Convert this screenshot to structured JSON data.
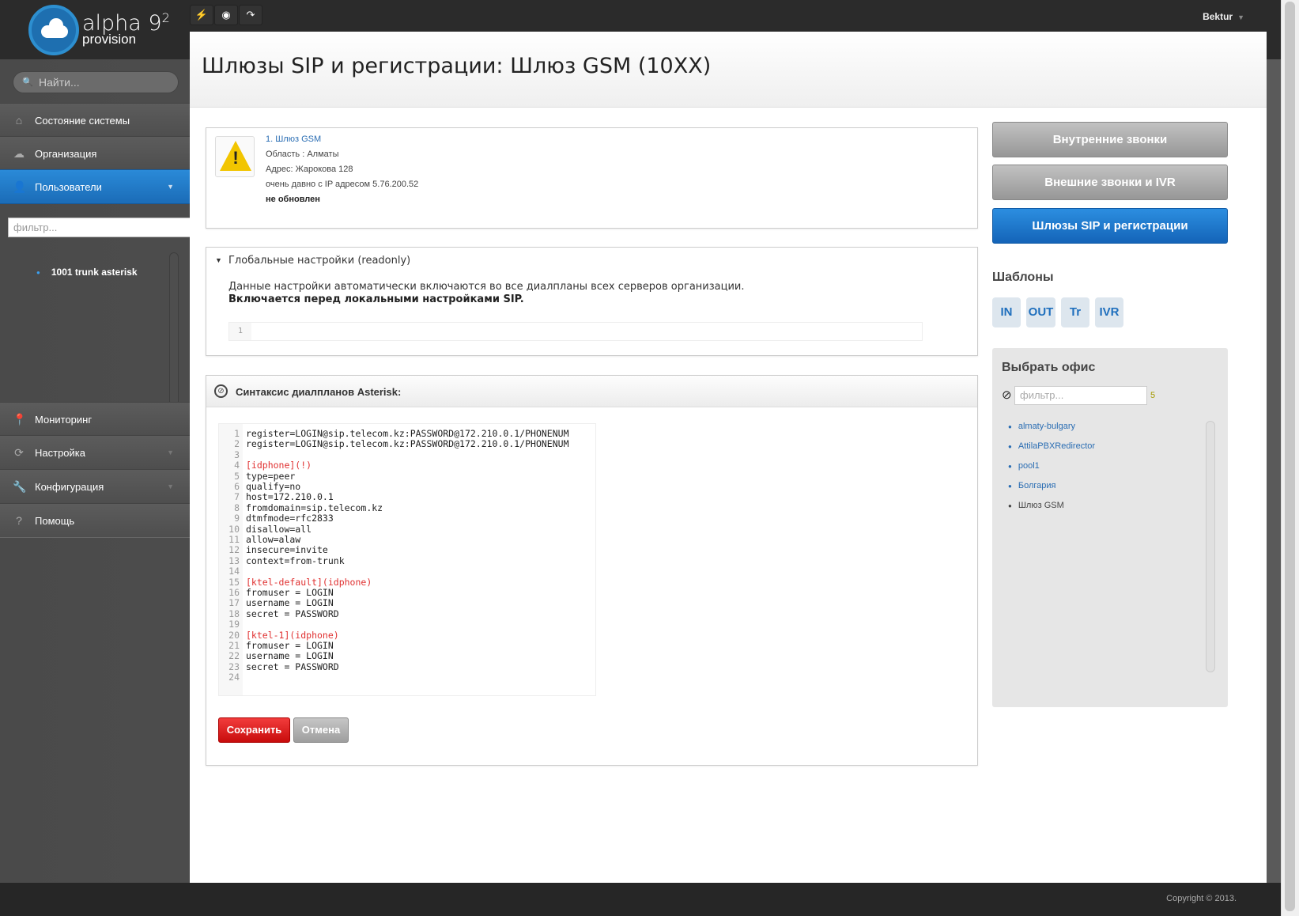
{
  "brand": {
    "name": "alpha 9",
    "sup": "2",
    "sub": "provision"
  },
  "toolbar": {
    "tool_icons": [
      "bolt-icon",
      "eye-icon",
      "redo-icon"
    ],
    "bolt": "⚡",
    "eye": "◉",
    "redo": "↷"
  },
  "user": {
    "name": "Bektur",
    "caret": "▼"
  },
  "sidebar": {
    "search_placeholder": "Найти...",
    "search_icon": "🔍",
    "items": [
      {
        "label": "Состояние системы",
        "icon": "home-icon",
        "glyph": "⌂"
      },
      {
        "label": "Организация",
        "icon": "cloud-icon",
        "glyph": "☁"
      },
      {
        "label": "Пользователи",
        "icon": "user-icon",
        "glyph": "👤",
        "active": true
      },
      {
        "label": "Мониторинг",
        "icon": "pin-icon",
        "glyph": "📍"
      },
      {
        "label": "Настройка",
        "icon": "refresh-icon",
        "glyph": "⟳"
      },
      {
        "label": "Конфигурация",
        "icon": "wrench-icon",
        "glyph": "🔧"
      },
      {
        "label": "Помощь",
        "icon": "help-icon",
        "glyph": "?"
      }
    ],
    "arrow": "▼",
    "filter_placeholder": "фильтр...",
    "tree": [
      {
        "bullet": "●",
        "label": "1001  trunk asterisk"
      }
    ]
  },
  "page": {
    "title": "Шлюзы SIP и регистрации: Шлюз GSM (10XX)"
  },
  "info": {
    "warning_mark": "!",
    "link": "1. Шлюз GSM",
    "region": "Область : Алматы",
    "address": "Адрес: Жарокова 128",
    "ip": "очень давно с IP адресом 5.76.200.52",
    "status": "не обновлен"
  },
  "global": {
    "caret": "▼",
    "title": "Глобальные настройки (readonly)",
    "desc": "Данные настройки автоматически включаются во все диалпланы всех серверов организации.",
    "bold": "Включается перед локальными настройками SIP.",
    "line_no": "1"
  },
  "syntax": {
    "icon_glyph": "⊘",
    "title": "Синтаксис диалпланов Asterisk:",
    "lines": [
      {
        "n": "1",
        "t": "register=LOGIN@sip.telecom.kz:PASSWORD@172.210.0.1/PHONENUM",
        "style": "normal"
      },
      {
        "n": "2",
        "t": "register=LOGIN@sip.telecom.kz:PASSWORD@172.210.0.1/PHONENUM",
        "style": "normal"
      },
      {
        "n": "3",
        "t": "",
        "style": "normal"
      },
      {
        "n": "4",
        "t": "[idphone](!)",
        "style": "red"
      },
      {
        "n": "5",
        "t": "type=peer",
        "style": "normal"
      },
      {
        "n": "6",
        "t": "qualify=no",
        "style": "normal"
      },
      {
        "n": "7",
        "t": "host=172.210.0.1",
        "style": "normal"
      },
      {
        "n": "8",
        "t": "fromdomain=sip.telecom.kz",
        "style": "normal"
      },
      {
        "n": "9",
        "t": "dtmfmode=rfc2833",
        "style": "normal"
      },
      {
        "n": "10",
        "t": "disallow=all",
        "style": "normal"
      },
      {
        "n": "11",
        "t": "allow=alaw",
        "style": "normal"
      },
      {
        "n": "12",
        "t": "insecure=invite",
        "style": "normal"
      },
      {
        "n": "13",
        "t": "context=from-trunk",
        "style": "normal"
      },
      {
        "n": "14",
        "t": "",
        "style": "normal"
      },
      {
        "n": "15",
        "t": "[ktel-default](idphone)",
        "style": "red"
      },
      {
        "n": "16",
        "t": "fromuser = LOGIN",
        "style": "normal"
      },
      {
        "n": "17",
        "t": "username = LOGIN",
        "style": "normal"
      },
      {
        "n": "18",
        "t": "secret = PASSWORD",
        "style": "normal"
      },
      {
        "n": "19",
        "t": "",
        "style": "normal"
      },
      {
        "n": "20",
        "t": "[ktel-1](idphone)",
        "style": "red"
      },
      {
        "n": "21",
        "t": "fromuser = LOGIN",
        "style": "normal"
      },
      {
        "n": "22",
        "t": "username = LOGIN",
        "style": "normal"
      },
      {
        "n": "23",
        "t": "secret = PASSWORD",
        "style": "normal"
      },
      {
        "n": "24",
        "t": "",
        "style": "normal"
      }
    ],
    "save_label": "Сохранить",
    "cancel_label": "Отмена"
  },
  "right": {
    "buttons": [
      {
        "label": "Внутренние звонки",
        "style": "gray"
      },
      {
        "label": "Внешние звонки и IVR",
        "style": "gray"
      },
      {
        "label": "Шлюзы SIP и регистрации",
        "style": "blue"
      }
    ],
    "templates_title": "Шаблоны",
    "templates": [
      "IN",
      "OUT",
      "Tr",
      "IVR"
    ],
    "office_title": "Выбрать офис",
    "office_icon": "⊘",
    "office_filter_placeholder": "фильтр...",
    "office_count": "5",
    "offices": [
      {
        "label": "almaty-bulgary",
        "link": true
      },
      {
        "label": "AttilaPBXRedirector",
        "link": true
      },
      {
        "label": "pool1",
        "link": true
      },
      {
        "label": "Болгария",
        "link": true
      },
      {
        "label": "Шлюз GSM",
        "link": false
      }
    ],
    "bullet": "●"
  },
  "footer": {
    "copyright": "Copyright © 2013."
  },
  "colors": {
    "accent": "#1b6cb7",
    "danger": "#d81e1e",
    "link": "#2a6db3"
  }
}
